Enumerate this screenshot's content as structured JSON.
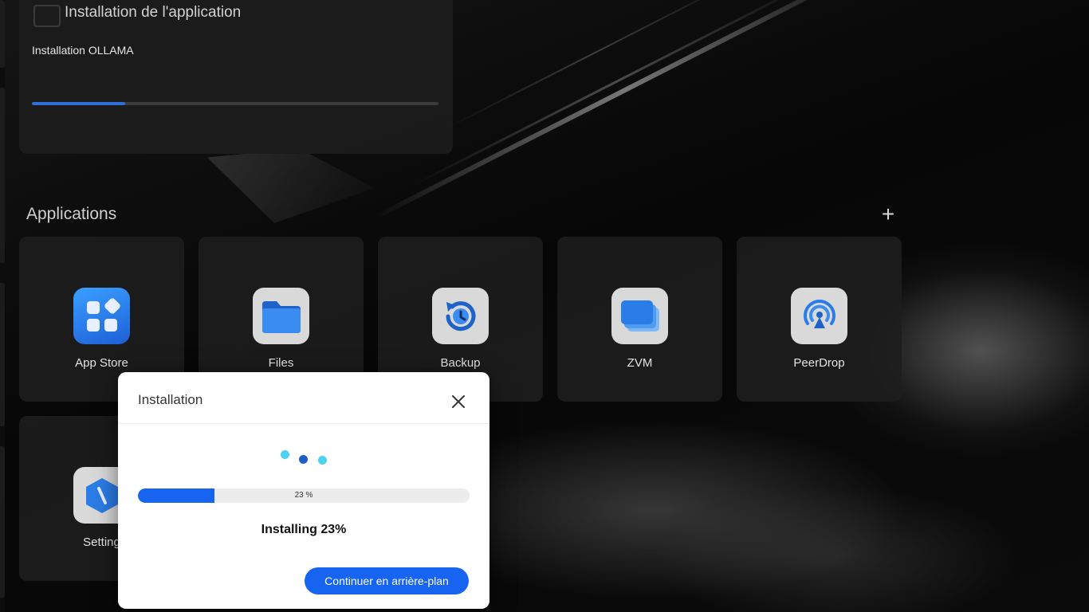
{
  "install_widget": {
    "title": "Installation de l'application",
    "subtitle": "Installation OLLAMA",
    "progress": 0.23
  },
  "applications": {
    "heading": "Applications",
    "add_label": "+",
    "tiles": [
      {
        "label": "App Store",
        "icon": "app-store-icon"
      },
      {
        "label": "Files",
        "icon": "folder-icon"
      },
      {
        "label": "Backup",
        "icon": "backup-clock-icon"
      },
      {
        "label": "ZVM",
        "icon": "zvm-windows-icon"
      },
      {
        "label": "PeerDrop",
        "icon": "peerdrop-broadcast-icon"
      },
      {
        "label": "Setting",
        "icon": "settings-hexagon-icon"
      }
    ]
  },
  "install_dialog": {
    "title": "Installation",
    "progress": 0.23,
    "progress_label": "23 %",
    "status": "Installing 23%",
    "background_button": "Continuer en arrière-plan"
  },
  "colors": {
    "accent": "#1664f0",
    "widget_progress": "#2f6fd6",
    "spinner_light": "#4fd1f0",
    "spinner_dark": "#1d5fc4"
  }
}
